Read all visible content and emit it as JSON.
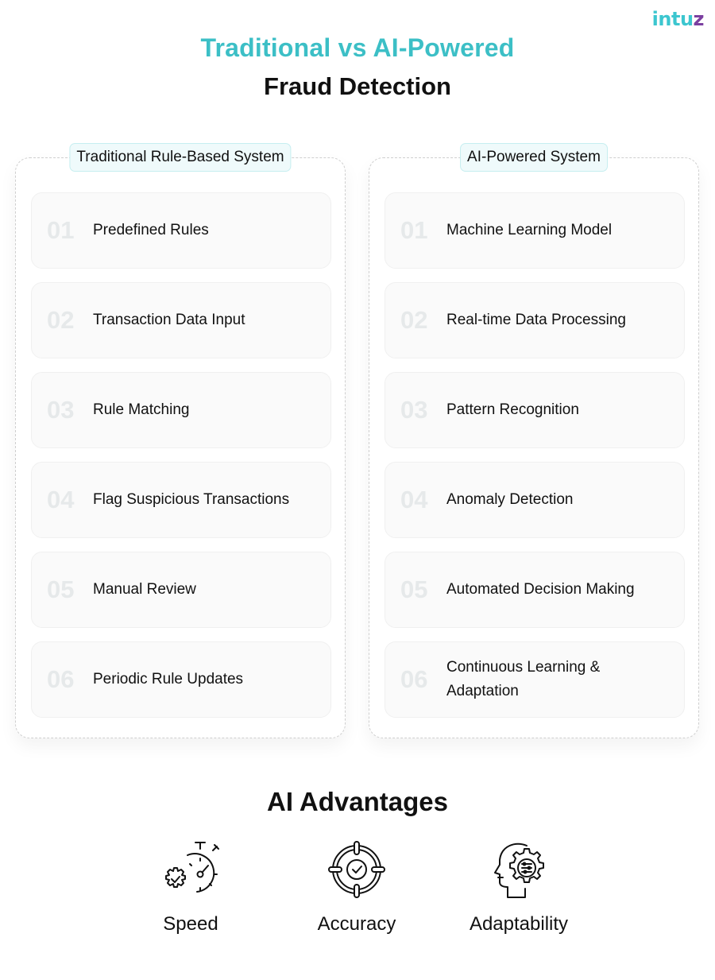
{
  "brand": {
    "logo_part1": "intu",
    "logo_part2": "z"
  },
  "header": {
    "title_line1": "Traditional vs AI-Powered",
    "title_line2": "Fraud Detection"
  },
  "colors": {
    "accent": "#3cbfc6",
    "label_bg": "#effafb",
    "card_bg": "#fafafa",
    "number": "#e6e9ea"
  },
  "traditional": {
    "label": "Traditional Rule-Based System",
    "steps": [
      {
        "num": "01",
        "label": "Predefined Rules"
      },
      {
        "num": "02",
        "label": "Transaction Data Input"
      },
      {
        "num": "03",
        "label": "Rule Matching"
      },
      {
        "num": "04",
        "label": "Flag Suspicious Transactions"
      },
      {
        "num": "05",
        "label": "Manual Review"
      },
      {
        "num": "06",
        "label": "Periodic Rule Updates"
      }
    ]
  },
  "ai": {
    "label": "AI-Powered System",
    "steps": [
      {
        "num": "01",
        "label": "Machine Learning Model"
      },
      {
        "num": "02",
        "label": "Real-time Data Processing"
      },
      {
        "num": "03",
        "label": "Pattern Recognition"
      },
      {
        "num": "04",
        "label": "Anomaly Detection"
      },
      {
        "num": "05",
        "label": "Automated Decision Making"
      },
      {
        "num": "06",
        "label": "Continuous Learning & Adaptation"
      }
    ]
  },
  "advantages": {
    "title": "AI Advantages",
    "items": [
      {
        "icon": "stopwatch-gear-icon",
        "label": "Speed"
      },
      {
        "icon": "target-check-icon",
        "label": "Accuracy"
      },
      {
        "icon": "head-gear-icon",
        "label": "Adaptability"
      }
    ]
  }
}
